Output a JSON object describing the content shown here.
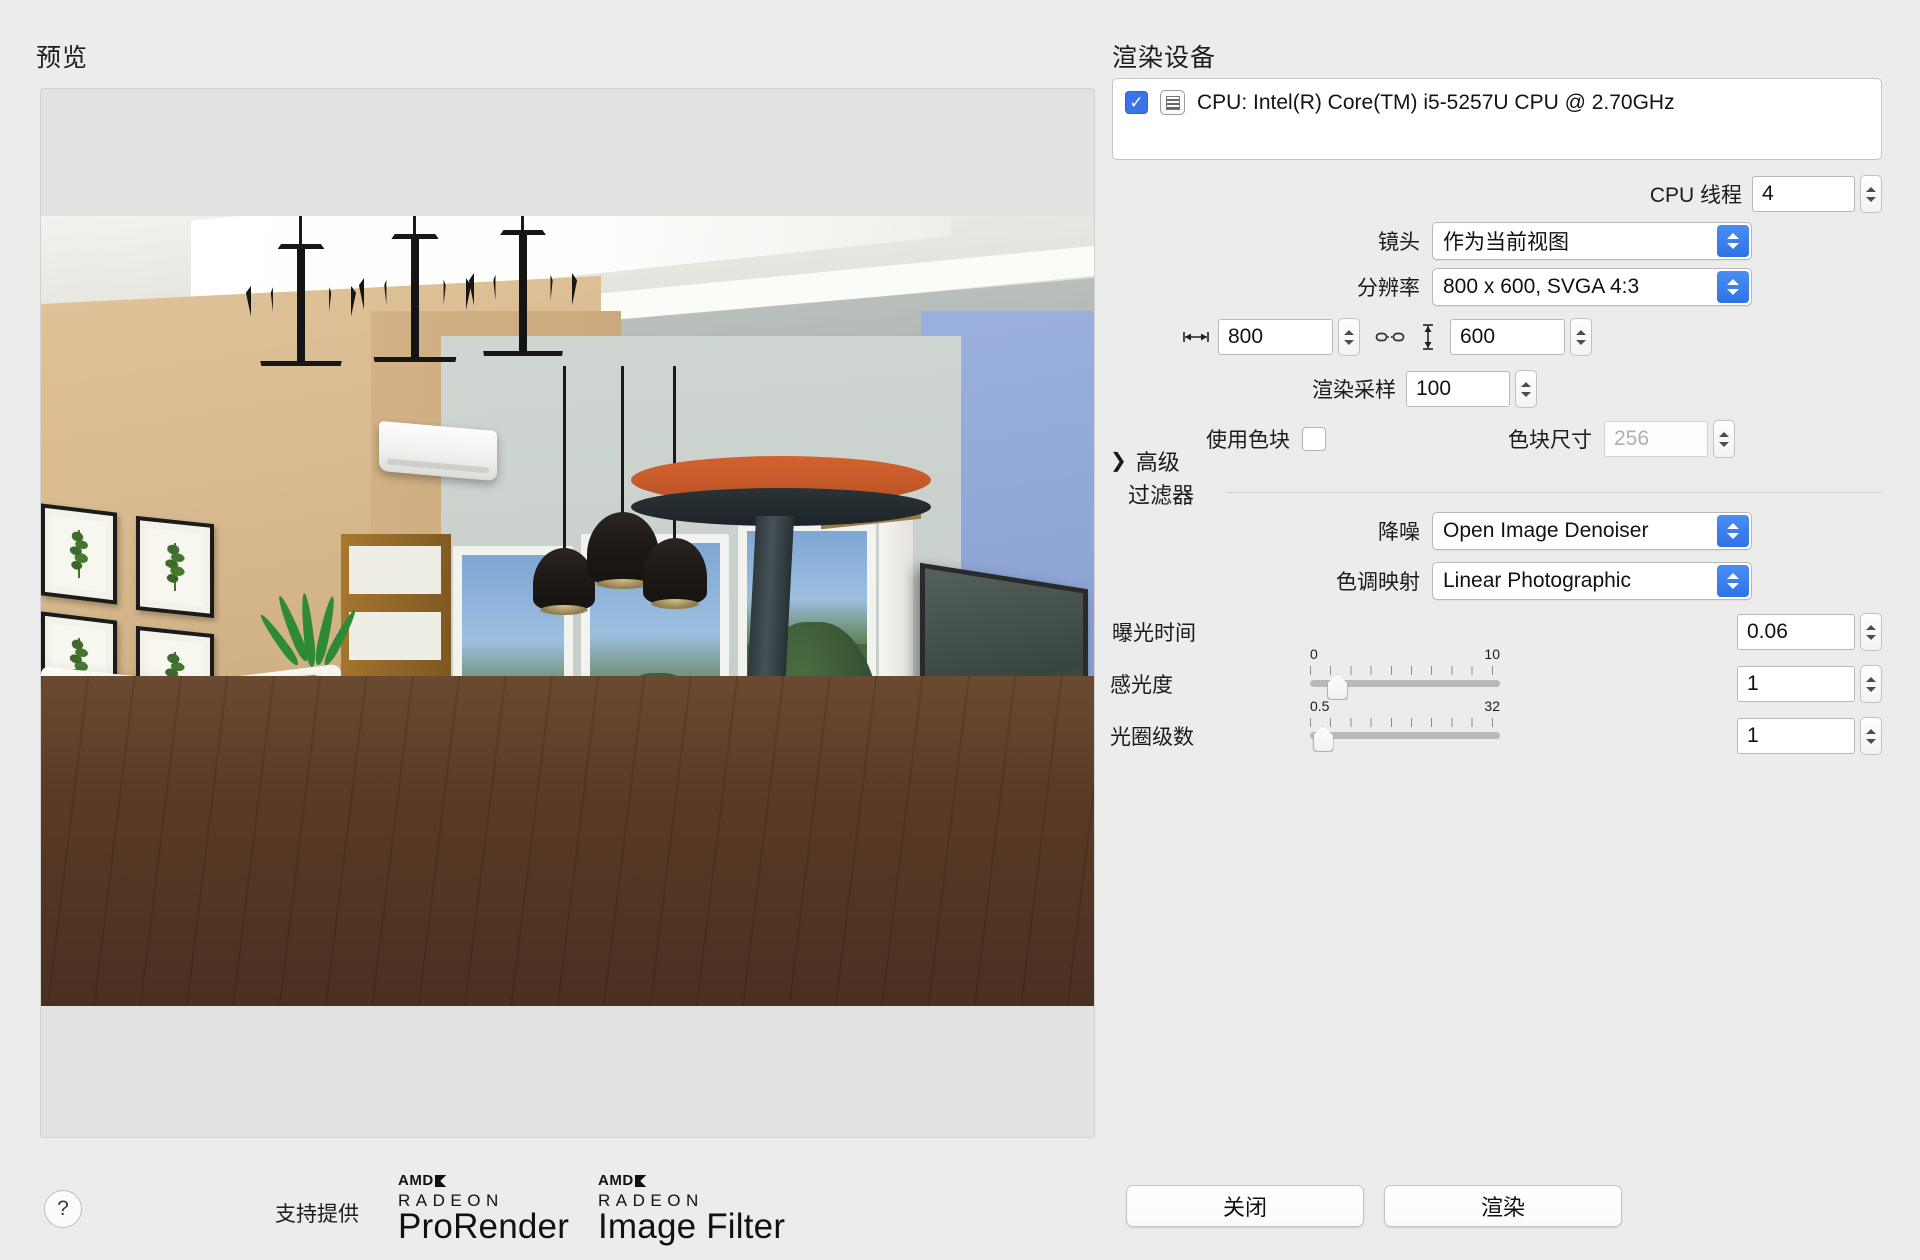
{
  "preview": {
    "title": "预览"
  },
  "render_device": {
    "title": "渲染设备",
    "checkbox_checked": true,
    "check_glyph": "✓",
    "device_label": "CPU: Intel(R) Core(TM) i5-5257U CPU @ 2.70GHz",
    "chip_icon": "cpu-chip-icon"
  },
  "settings": {
    "cpu_threads_label": "CPU 线程",
    "cpu_threads_value": "4",
    "camera_label": "镜头",
    "camera_value": "作为当前视图",
    "resolution_label": "分辨率",
    "resolution_value": "800 x 600, SVGA 4:3",
    "width_value": "800",
    "height_value": "600",
    "width_icon": "width-arrows-icon",
    "link_icon": "broken-link-icon",
    "height_icon": "height-arrows-icon",
    "samples_label": "渲染采样",
    "samples_value": "100",
    "use_tiles_label": "使用色块",
    "use_tiles_checked": false,
    "tile_size_label": "色块尺寸",
    "tile_size_value": "256",
    "tile_size_disabled": true
  },
  "advanced": {
    "label": "高级",
    "chevron": "❯",
    "expanded": false
  },
  "filters": {
    "section_label": "过滤器",
    "denoise_label": "降噪",
    "denoise_value": "Open Image Denoiser",
    "tonemap_label": "色调映射",
    "tonemap_value": "Linear Photographic",
    "exposure_label": "曝光时间",
    "exposure_value": "0.06",
    "iso_label": "感光度",
    "iso_min": "0",
    "iso_max": "10",
    "iso_value": "1",
    "iso_fraction": 0.1,
    "fstop_label": "光圈级数",
    "fstop_min": "0.5",
    "fstop_max": "32",
    "fstop_value": "1",
    "fstop_fraction": 0.015
  },
  "footer": {
    "help_glyph": "?",
    "powered_label": "支持提供",
    "logo1": {
      "amd": "AMD",
      "radeon": "RADEON",
      "product": "ProRender"
    },
    "logo2": {
      "amd": "AMD",
      "radeon": "RADEON",
      "product": "Image Filter"
    },
    "close_button": "关闭",
    "render_button": "渲染"
  },
  "colors": {
    "accent_blue": "#2f72e6",
    "checkbox_blue": "#3b74e8",
    "window_bg": "#ececec",
    "panel_bg": "#e2e2e2"
  }
}
